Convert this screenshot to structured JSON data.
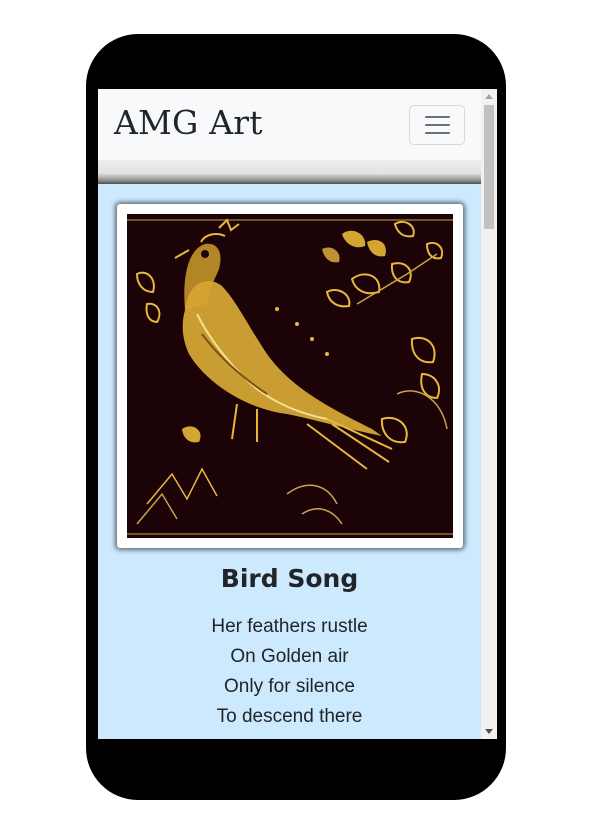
{
  "navbar": {
    "brand": "AMG Art",
    "toggler_icon": "hamburger-menu-icon"
  },
  "artwork": {
    "title": "Bird Song",
    "image_icon": "bird-artwork-image",
    "poem_lines": [
      "Her feathers rustle",
      "On Golden air",
      "Only for silence",
      "To descend there"
    ]
  },
  "colors": {
    "content_background": "#cce9fd",
    "navbar_background": "#f8f9fa",
    "art_background": "#1b0308",
    "art_gold": "#e8b83a"
  }
}
